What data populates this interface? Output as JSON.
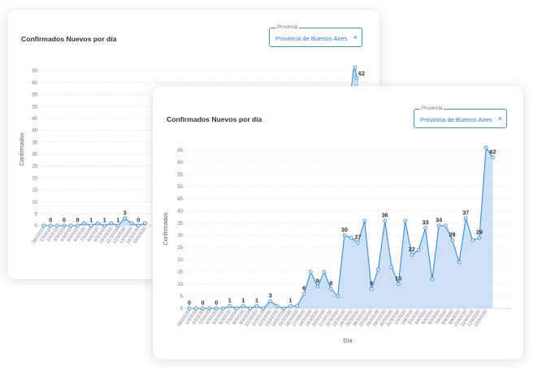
{
  "back_card": {
    "title": "Confirmados Nuevos por día",
    "filter": {
      "label": "Provincia",
      "value": "Provincia de Buenos Aires",
      "close": "×"
    }
  },
  "front_card": {
    "title": "Confirmados Nuevos por día",
    "filter": {
      "label": "Provincia",
      "value": "Provincia de Buenos Aires",
      "close": "×"
    }
  },
  "chart_data": [
    {
      "type": "area",
      "xlabel": "",
      "ylabel": "Confirmados",
      "ylim": [
        0,
        65
      ],
      "yticks": [
        0,
        5,
        10,
        15,
        20,
        25,
        30,
        35,
        40,
        45,
        50,
        55,
        60,
        65
      ],
      "categories": [
        "29/2/2020",
        "1/3/2020",
        "2/3/2020",
        "3/3/2020",
        "4/3/2020",
        "5/3/2020",
        "6/3/2020",
        "7/3/2020",
        "8/3/2020",
        "9/3/2020",
        "10/3/2020",
        "11/3/2020",
        "12/3/2020",
        "13/3/2020",
        "14/3/2020",
        "15/3/2020"
      ],
      "values": [
        0,
        0,
        0,
        0,
        0,
        0,
        1,
        0,
        1,
        0,
        1,
        0,
        3,
        1,
        0,
        1
      ],
      "point_labels": [
        {
          "index": 1,
          "text": "0"
        },
        {
          "index": 3,
          "text": "0"
        },
        {
          "index": 5,
          "text": "0"
        },
        {
          "index": 7,
          "text": "1"
        },
        {
          "index": 9,
          "text": "1"
        },
        {
          "index": 11,
          "text": "1"
        },
        {
          "index": 12,
          "text": "3"
        },
        {
          "index": 14,
          "text": "0"
        }
      ],
      "peak_label": "62",
      "grid": true
    },
    {
      "type": "area",
      "xlabel": "Día",
      "ylabel": "Confirmados",
      "ylim": [
        0,
        65
      ],
      "yticks": [
        0,
        5,
        10,
        15,
        20,
        25,
        30,
        35,
        40,
        45,
        50,
        55,
        60,
        65
      ],
      "categories": [
        "29/2/2020",
        "1/3/2020",
        "2/3/2020",
        "3/3/2020",
        "4/3/2020",
        "5/3/2020",
        "6/3/2020",
        "7/3/2020",
        "8/3/2020",
        "9/3/2020",
        "10/3/2020",
        "11/3/2020",
        "12/3/2020",
        "13/3/2020",
        "14/3/2020",
        "15/3/2020",
        "16/3/2020",
        "17/3/2020",
        "18/3/2020",
        "19/3/2020",
        "20/3/2020",
        "21/3/2020",
        "22/3/2020",
        "23/3/2020",
        "24/3/2020",
        "25/3/2020",
        "26/3/2020",
        "27/3/2020",
        "28/3/2020",
        "29/3/2020",
        "30/3/2020",
        "31/3/2020",
        "1/4/2020",
        "2/4/2020",
        "3/4/2020",
        "4/4/2020",
        "5/4/2020",
        "6/4/2020",
        "7/4/2020",
        "8/4/2020",
        "9/4/2020",
        "10/4/2020",
        "11/4/2020",
        "12/4/2020",
        "13/4/2020"
      ],
      "values": [
        0,
        0,
        0,
        0,
        0,
        0,
        1,
        0,
        1,
        0,
        1,
        0,
        3,
        1,
        0,
        1,
        1,
        6,
        15,
        9,
        15,
        8,
        5,
        30,
        29,
        27,
        36,
        8,
        16,
        36,
        17,
        10,
        36,
        22,
        24,
        33,
        12,
        34,
        34,
        28,
        19,
        37,
        28,
        29,
        66,
        62
      ],
      "point_labels": [
        {
          "index": 0,
          "text": "0"
        },
        {
          "index": 2,
          "text": "0"
        },
        {
          "index": 4,
          "text": "0"
        },
        {
          "index": 6,
          "text": "1"
        },
        {
          "index": 8,
          "text": "1"
        },
        {
          "index": 10,
          "text": "1"
        },
        {
          "index": 12,
          "text": "3"
        },
        {
          "index": 15,
          "text": "1"
        },
        {
          "index": 17,
          "text": "6"
        },
        {
          "index": 19,
          "text": "9"
        },
        {
          "index": 21,
          "text": "8"
        },
        {
          "index": 23,
          "text": "30"
        },
        {
          "index": 25,
          "text": "27"
        },
        {
          "index": 27,
          "text": "8"
        },
        {
          "index": 29,
          "text": "36"
        },
        {
          "index": 31,
          "text": "10"
        },
        {
          "index": 33,
          "text": "22"
        },
        {
          "index": 35,
          "text": "33"
        },
        {
          "index": 37,
          "text": "34"
        },
        {
          "index": 39,
          "text": "28"
        },
        {
          "index": 41,
          "text": "37"
        },
        {
          "index": 43,
          "text": "29"
        },
        {
          "index": 45,
          "text": "62"
        }
      ],
      "grid": true
    }
  ]
}
